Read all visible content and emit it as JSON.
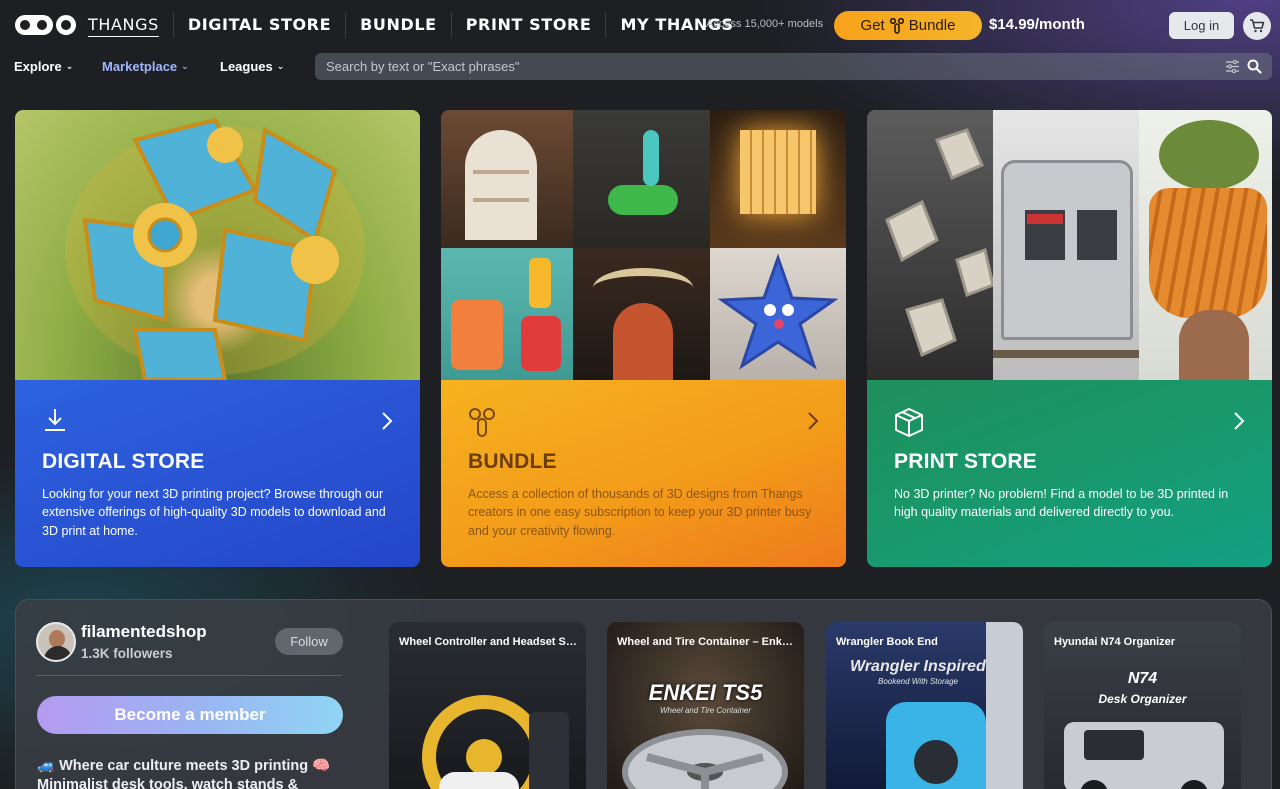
{
  "header": {
    "nav": [
      "THANGS",
      "DIGITAL STORE",
      "BUNDLE",
      "PRINT STORE",
      "MY THANGS"
    ],
    "access_text": "Access 15,000+ models",
    "bundle_button": {
      "get": "Get",
      "label": "Bundle"
    },
    "price": "$14.99/month",
    "login": "Log in"
  },
  "subnav": {
    "items": [
      "Explore",
      "Marketplace",
      "Leagues"
    ],
    "search_placeholder": "Search by text or \"Exact phrases\""
  },
  "cards": [
    {
      "title": "DIGITAL STORE",
      "description": "Looking for your next 3D printing project? Browse through our extensive offerings of high-quality 3D models to download and 3D print at home.",
      "icon": "download-icon"
    },
    {
      "title": "BUNDLE",
      "description": "Access a collection of thousands of 3D designs from Thangs creators in one easy subscription to keep your 3D printer busy and your creativity flowing.",
      "icon": "bundle-logo-icon"
    },
    {
      "title": "PRINT STORE",
      "description": "No 3D printer? No problem! Find a model to be 3D printed in high quality materials and delivered directly to you.",
      "icon": "box-icon"
    }
  ],
  "creator": {
    "name": "filamentedshop",
    "followers": "1.3K followers",
    "follow": "Follow",
    "member_button": "Become a member",
    "bio_line1": "🚙 Where car culture meets 3D printing 🧠",
    "bio_line2": "Minimalist desk tools, watch stands &"
  },
  "models": [
    {
      "title": "Wheel Controller and Headset Sta..."
    },
    {
      "title": "Wheel and Tire Container – Enkei ...",
      "overlay": "ENKEI TS5",
      "overlay_sub": "Wheel and Tire Container"
    },
    {
      "title": "Wrangler Book End",
      "overlay": "Wrangler Inspired",
      "overlay_sub": "Bookend With Storage"
    },
    {
      "title": "Hyundai N74 Organizer",
      "overlay": "N74",
      "overlay_sub": "Desk Organizer"
    }
  ],
  "colors": {
    "digital": "#2446c8",
    "bundle": "#f39c1a",
    "print": "#179a70",
    "bundle_button": "#f7a21a"
  }
}
